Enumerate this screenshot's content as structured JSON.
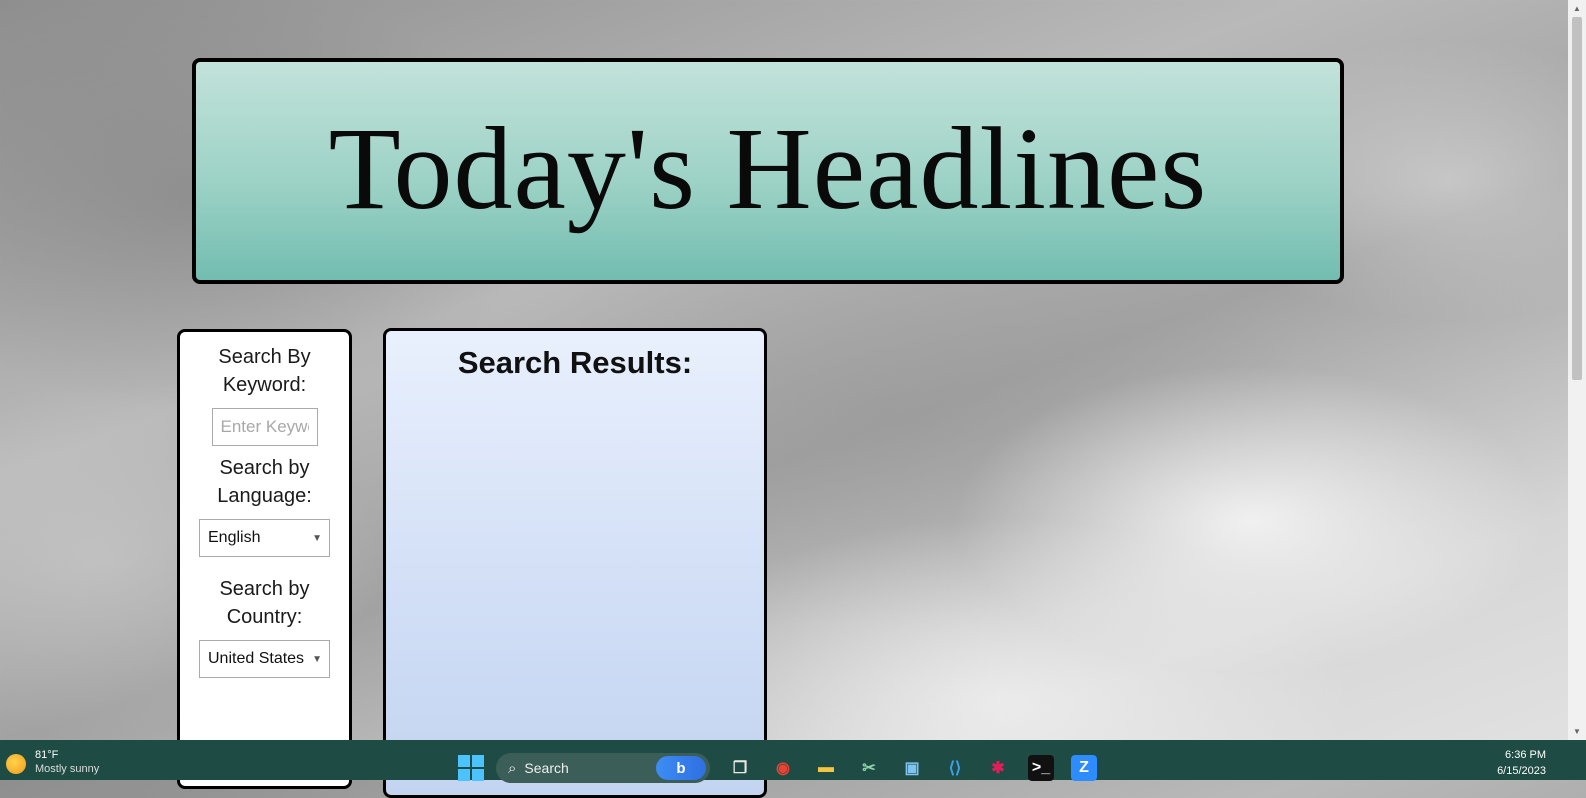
{
  "header": {
    "title": "Today's Headlines"
  },
  "search_panel": {
    "keyword_label": "Search By Keyword:",
    "keyword_placeholder": "Enter Keyword",
    "keyword_value": "",
    "language_label": "Search by Language:",
    "language_selected": "English",
    "country_label": "Search by Country:",
    "country_selected": "United States"
  },
  "results_panel": {
    "title": "Search Results:"
  },
  "taskbar": {
    "weather_temp": "81°F",
    "weather_condition": "Mostly sunny",
    "search_label": "Search",
    "bing_label": "b",
    "time": "6:36 PM",
    "date": "6/15/2023",
    "apps": [
      {
        "icon": "task-view-icon",
        "glyph": "❐",
        "color": "#e8e8e8",
        "bg": "transparent"
      },
      {
        "icon": "chrome-icon",
        "glyph": "◉",
        "color": "#ea4335",
        "bg": "transparent"
      },
      {
        "icon": "file-explorer-icon",
        "glyph": "▬",
        "color": "#f5c542",
        "bg": "transparent"
      },
      {
        "icon": "snipping-tool-icon",
        "glyph": "✂",
        "color": "#8fd3a8",
        "bg": "transparent"
      },
      {
        "icon": "photos-icon",
        "glyph": "▣",
        "color": "#7fc4f0",
        "bg": "transparent"
      },
      {
        "icon": "vscode-icon",
        "glyph": "⟨⟩",
        "color": "#3ea0f0",
        "bg": "transparent"
      },
      {
        "icon": "slack-icon",
        "glyph": "✱",
        "color": "#e01e5a",
        "bg": "transparent"
      },
      {
        "icon": "terminal-icon",
        "glyph": ">_",
        "color": "#ffffff",
        "bg": "#111111"
      },
      {
        "icon": "zoom-icon",
        "glyph": "Z",
        "color": "#ffffff",
        "bg": "#2d8cff"
      }
    ]
  }
}
